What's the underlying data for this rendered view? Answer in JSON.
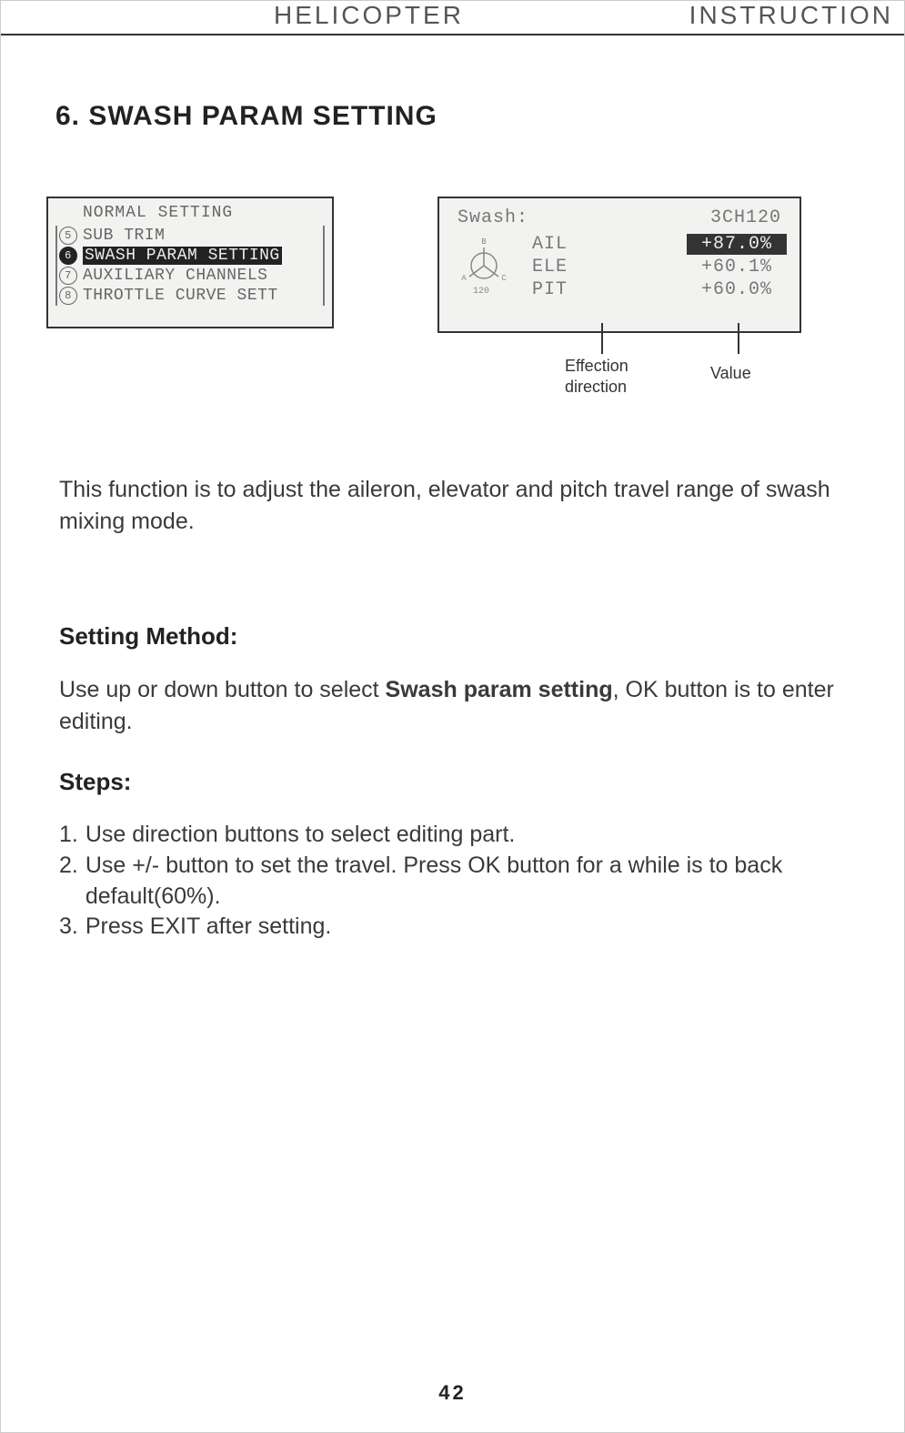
{
  "header": {
    "left": "HELICOPTER",
    "right": "INSTRUCTION"
  },
  "section_title": "6. SWASH PARAM SETTING",
  "lcd1": {
    "title": "NORMAL SETTING",
    "items": [
      {
        "idx": "5",
        "label": "SUB TRIM",
        "selected": false
      },
      {
        "idx": "6",
        "label": "SWASH PARAM SETTING",
        "selected": true
      },
      {
        "idx": "7",
        "label": "AUXILIARY CHANNELS",
        "selected": false
      },
      {
        "idx": "8",
        "label": "THROTTLE CURVE SETT",
        "selected": false
      }
    ]
  },
  "lcd2": {
    "title": "Swash:",
    "mode": "3CH120",
    "rows": [
      {
        "name": "AIL",
        "value": "+87.0%",
        "selected": true
      },
      {
        "name": "ELE",
        "value": "+60.1%",
        "selected": false
      },
      {
        "name": "PIT",
        "value": "+60.0%",
        "selected": false
      }
    ],
    "icon_caption": "120"
  },
  "callouts": {
    "direction": "Effection\ndirection",
    "value": "Value"
  },
  "intro": "This function is to adjust the aileron, elevator and pitch travel range of swash mixing mode.",
  "method_heading": "Setting Method:",
  "method_text_a": "Use up or down button to select ",
  "method_text_bold": "Swash param setting",
  "method_text_b": ", OK button is to enter editing.",
  "steps_heading": "Steps:",
  "steps": [
    {
      "n": "1.",
      "t": "Use direction buttons to select editing part."
    },
    {
      "n": "2.",
      "t": "Use +/- button to set the travel. Press OK button for a while is to back default(60%)."
    },
    {
      "n": "3.",
      "t": "Press EXIT after setting."
    }
  ],
  "page_number": "42"
}
